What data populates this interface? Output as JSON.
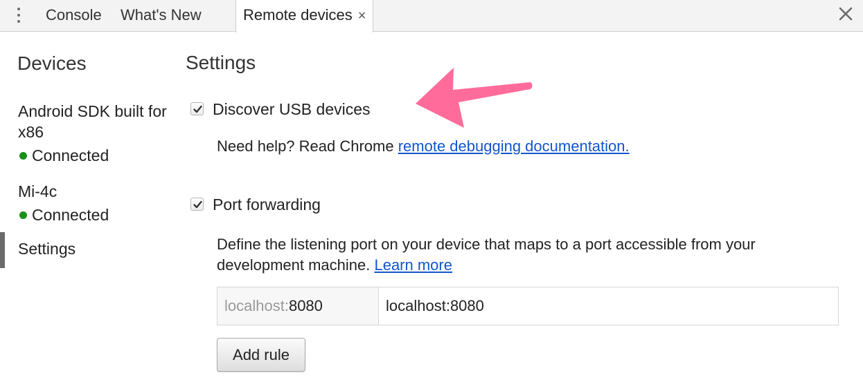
{
  "tabs": [
    {
      "label": "Console"
    },
    {
      "label": "What's New"
    },
    {
      "label": "Remote devices",
      "close_glyph": "×"
    }
  ],
  "sidebar": {
    "title": "Devices",
    "devices": [
      {
        "name": "Android SDK built for x86",
        "status": "Connected"
      },
      {
        "name": "Mi-4c",
        "status": "Connected"
      }
    ],
    "settings_label": "Settings"
  },
  "settings": {
    "title": "Settings",
    "discover_usb": {
      "label": "Discover USB devices",
      "checked": true,
      "help_prefix": "Need help? Read Chrome ",
      "help_link": "remote debugging documentation."
    },
    "port_forwarding": {
      "label": "Port forwarding",
      "checked": true,
      "description": "Define the listening port on your device that maps to a port accessible from your development machine. ",
      "learn_more": "Learn more"
    },
    "rule": {
      "device_host": "localhost:",
      "device_port": "8080",
      "local_address": "localhost:8080"
    },
    "add_rule_label": "Add rule"
  },
  "colors": {
    "status_connected": "#1a8f1a",
    "link": "#1155cc",
    "annotation_arrow": "#ff6b9a"
  },
  "icons": {
    "menu": "more-vertical-icon",
    "close_panel": "close-icon",
    "checkbox": "checkmark-icon",
    "annotation": "arrow-icon"
  }
}
